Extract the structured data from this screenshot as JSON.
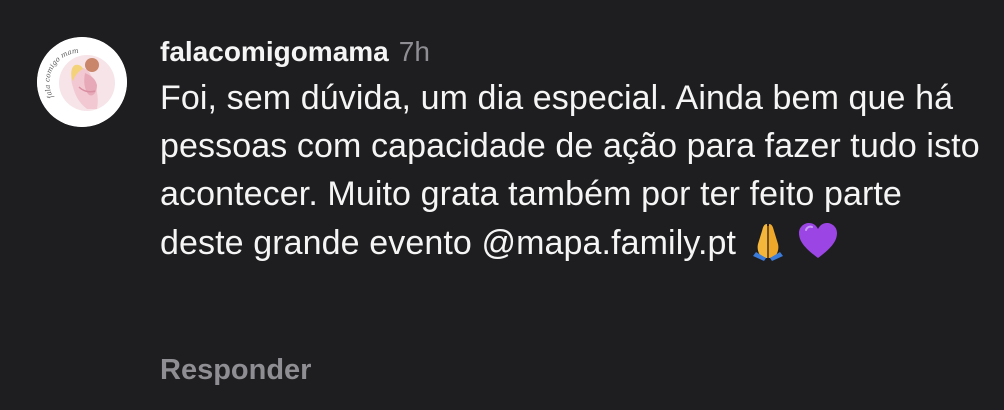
{
  "comment": {
    "username": "falacomigomama",
    "timestamp": "7h",
    "text_before_mention": "Foi, sem dúvida, um dia especial. Ainda bem que há pessoas com capacidade de ação para fazer tudo isto acontecer. Muito grata também por ter feito parte deste grande evento ",
    "mention": "@mapa.family.pt",
    "emojis": [
      "folded-hands-icon",
      "purple-heart-icon"
    ],
    "reply_label": "Responder"
  },
  "avatar": {
    "logo_text": "fala comigo mamã"
  },
  "colors": {
    "background": "#1e1e20",
    "text": "#f5f5f5",
    "muted": "#8e8e93",
    "heart": "#9b45e4",
    "hands": "#f4b73b"
  }
}
